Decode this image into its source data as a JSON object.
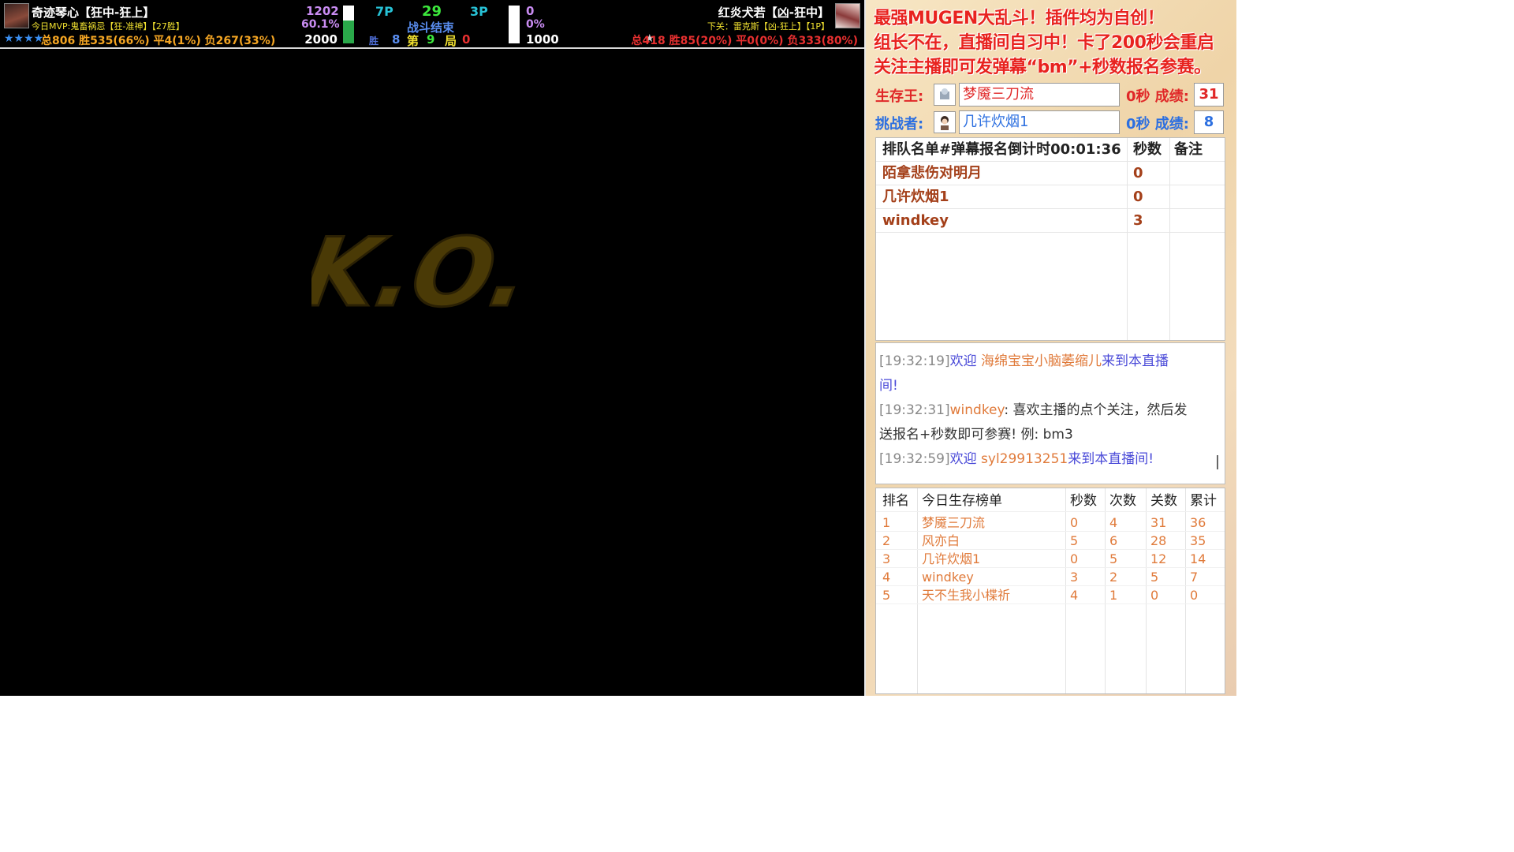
{
  "hud": {
    "left_player": {
      "name": "奇迹琴心【狂中-狂上】",
      "mvp_line": "今日MVP:鬼畜祸忌【狂-准神】【27胜】",
      "stars": "★★★★",
      "record": "总806 胜535(66%) 平4(1%) 负267(33%)",
      "power_top": "1202",
      "power_pct": "60.1%",
      "power_max": "2000",
      "power_fill": 0.6
    },
    "center": {
      "left_slot": "7P",
      "timer": "29",
      "right_slot": "3P",
      "status": "战斗结束",
      "win_label": "胜",
      "win_count": "8",
      "round_label_pre": "第",
      "round_num": "9",
      "round_label_post": "局",
      "round_extra": "0"
    },
    "right_player": {
      "name": "红炎犬若【凶-狂中】",
      "next_line": "下关：雷克斯【凶-狂上】【1P】",
      "stars": "★",
      "record": "总418 胜85(20%) 平0(0%) 负333(80%)",
      "power_top": "0",
      "power_pct": "0%",
      "power_max": "1000",
      "power_fill": 0.0
    }
  },
  "ko_text": "K.O.",
  "side": {
    "banner": [
      "最强MUGEN大乱斗！插件均为自创！",
      "组长不在，直播间自习中！卡了200秒会重启",
      "关注主播即可发弹幕“bm”+秒数报名参赛。"
    ],
    "survivor": {
      "label": "生存王:",
      "name": "梦魇三刀流",
      "score_label": "0秒 成绩:",
      "score": "31"
    },
    "challenger": {
      "label": "挑战者:",
      "name": "几许炊烟1",
      "score_label": "0秒 成绩:",
      "score": "8"
    },
    "queue": {
      "header": [
        "排队名单#弹幕报名倒计时00:01:36",
        "秒数",
        "备注"
      ],
      "rows": [
        {
          "name": "陌拿悲伤对明月",
          "seconds": "0",
          "note": ""
        },
        {
          "name": "几许炊烟1",
          "seconds": "0",
          "note": ""
        },
        {
          "name": "windkey",
          "seconds": "3",
          "note": ""
        }
      ]
    },
    "chat": [
      {
        "time": "[19:32:19]",
        "text": "欢迎 ",
        "user": "海绵宝宝小脑萎缩儿",
        "tail": "来到本直播",
        "wrap": "间!"
      },
      {
        "time": "[19:32:31]",
        "user": "windkey",
        "text": ": 喜欢主播的点个关注，然后发",
        "wrap": "送报名+秒数即可参赛! 例: bm3"
      },
      {
        "time": "[19:32:59]",
        "text": "欢迎 ",
        "user": "syl29913251",
        "tail": "来到本直播间!"
      }
    ],
    "ranking": {
      "header": [
        "排名",
        "今日生存榜单",
        "秒数",
        "次数",
        "关数",
        "累计"
      ],
      "rows": [
        [
          "1",
          "梦魇三刀流",
          "0",
          "4",
          "31",
          "36"
        ],
        [
          "2",
          "风亦白",
          "5",
          "6",
          "28",
          "35"
        ],
        [
          "3",
          "几许炊烟1",
          "0",
          "5",
          "12",
          "14"
        ],
        [
          "4",
          "windkey",
          "3",
          "2",
          "5",
          "7"
        ],
        [
          "5",
          "天不生我小楪祈",
          "4",
          "1",
          "0",
          "0"
        ]
      ]
    }
  },
  "colors": {
    "hp_green": "#2aa84a",
    "banner_red": "#e8231f",
    "survivor_red": "#e02828",
    "challenger_blue": "#2c6fe0",
    "queue_brown": "#a4401a",
    "rank_orange": "#e07a3a",
    "ko_gold": "#4a3a06"
  }
}
